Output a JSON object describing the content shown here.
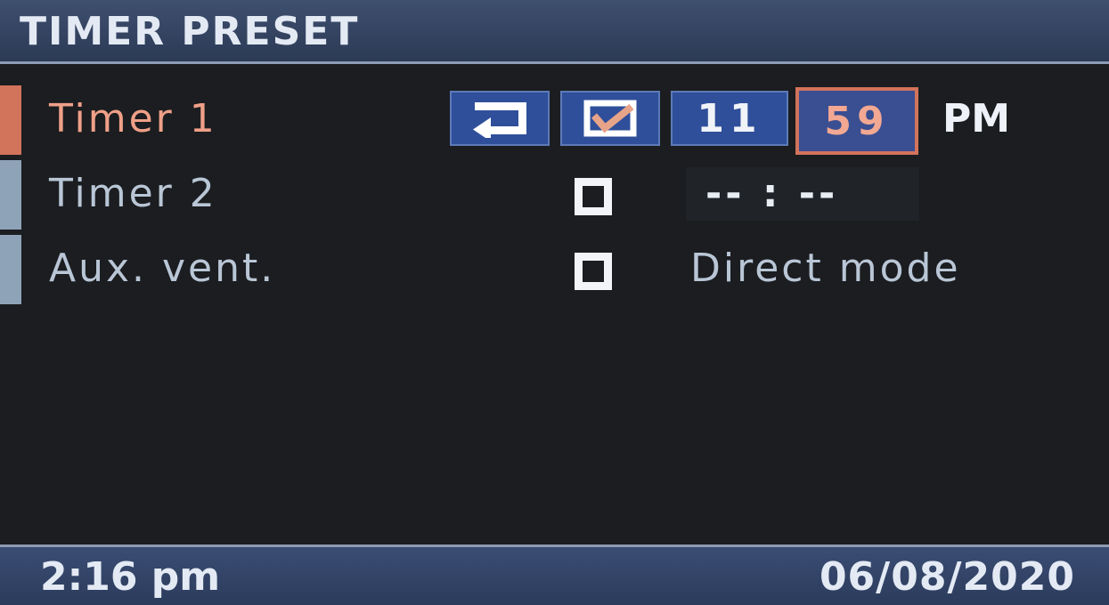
{
  "header": {
    "title": "TIMER PRESET"
  },
  "rows": [
    {
      "label": "Timer 1",
      "hour": "11",
      "minute": "59",
      "ampm": "PM",
      "back_icon": "back-arrow-icon",
      "checked_icon": "checked-box-icon"
    },
    {
      "label": "Timer 2",
      "time": "-- : --"
    },
    {
      "label": "Aux. vent.",
      "mode": "Direct mode"
    }
  ],
  "footer": {
    "time": "2:16 pm",
    "date": "06/08/2020"
  },
  "colors": {
    "accent": "#d2735c",
    "button_blue": "#2f4f9a",
    "header_bg": "#3e4f6f",
    "background": "#1b1d20"
  }
}
